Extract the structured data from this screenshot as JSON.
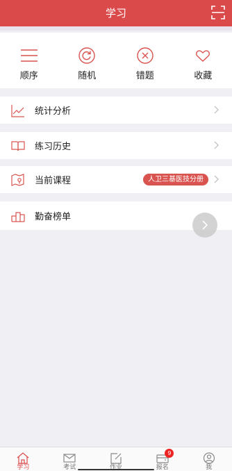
{
  "header": {
    "title": "学习"
  },
  "quick_actions": [
    {
      "label": "顺序",
      "icon": "list-icon"
    },
    {
      "label": "随机",
      "icon": "refresh-icon"
    },
    {
      "label": "错题",
      "icon": "close-circle-icon"
    },
    {
      "label": "收藏",
      "icon": "heart-icon"
    }
  ],
  "menu": [
    {
      "label": "统计分析",
      "icon": "chart-icon"
    },
    {
      "label": "练习历史",
      "icon": "book-icon"
    },
    {
      "label": "当前课程",
      "icon": "map-pin-icon",
      "badge": "人卫三基医技分册"
    },
    {
      "label": "勤奋榜单",
      "icon": "podium-icon"
    }
  ],
  "tabs": [
    {
      "label": "学习",
      "icon": "home-icon",
      "active": true
    },
    {
      "label": "考试",
      "icon": "mail-icon"
    },
    {
      "label": "作业",
      "icon": "edit-icon"
    },
    {
      "label": "报名",
      "icon": "wallet-icon",
      "count": "9"
    },
    {
      "label": "我",
      "icon": "user-icon"
    }
  ],
  "colors": {
    "brand": "#db4a4a",
    "badge": "#d9534f",
    "background": "#f0eff4"
  }
}
